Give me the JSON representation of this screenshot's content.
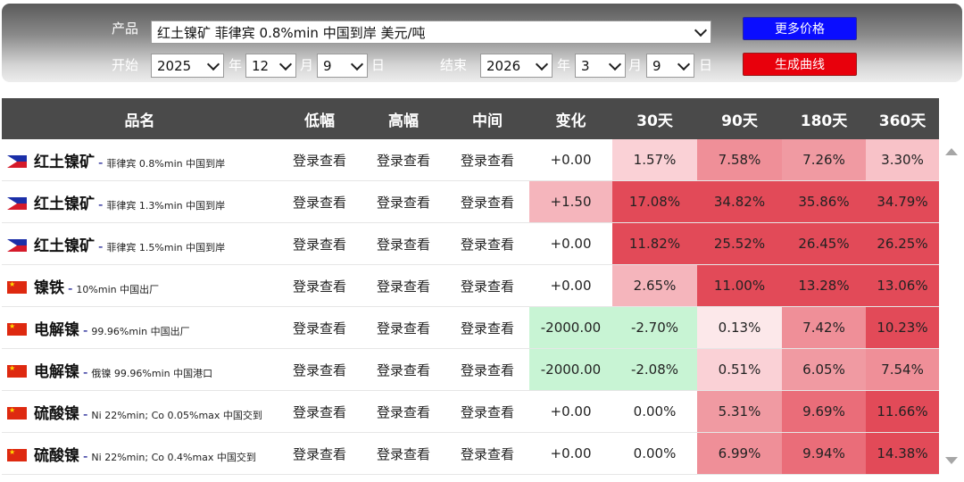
{
  "filter": {
    "product_label": "产品",
    "product_value": "红土镍矿 菲律宾 0.8%min 中国到岸 美元/吨",
    "start_label": "开始",
    "end_label": "结束",
    "start_year": "2025",
    "start_month": "12",
    "start_day": "9",
    "end_year": "2026",
    "end_month": "3",
    "end_day": "9",
    "year_unit": "年",
    "month_unit": "月",
    "day_unit": "日",
    "more_prices_label": "更多价格",
    "generate_curve_label": "生成曲线"
  },
  "table": {
    "headers": [
      "品名",
      "低幅",
      "高幅",
      "中间",
      "变化",
      "30天",
      "90天",
      "180天",
      "360天"
    ],
    "rows": [
      {
        "name": "红土镍矿",
        "spec": "菲律宾 0.8%min 中国到岸",
        "flag": "flag-philippines",
        "low": "登录查看",
        "high": "登录查看",
        "mid": "登录查看",
        "change": "+0.00",
        "d30": "1.57%",
        "d90": "7.58%",
        "d180": "7.26%",
        "d360": "3.30%"
      },
      {
        "name": "红土镍矿",
        "spec": "菲律宾 1.3%min 中国到岸",
        "flag": "flag-philippines",
        "low": "登录查看",
        "high": "登录查看",
        "mid": "登录查看",
        "change": "+1.50",
        "d30": "17.08%",
        "d90": "34.82%",
        "d180": "35.86%",
        "d360": "34.79%"
      },
      {
        "name": "红土镍矿",
        "spec": "菲律宾 1.5%min 中国到岸",
        "flag": "flag-philippines",
        "low": "登录查看",
        "high": "登录查看",
        "mid": "登录查看",
        "change": "+0.00",
        "d30": "11.82%",
        "d90": "25.52%",
        "d180": "26.45%",
        "d360": "26.25%"
      },
      {
        "name": "镍铁",
        "spec": "10%min 中国出厂",
        "flag": "flag-china",
        "low": "登录查看",
        "high": "登录查看",
        "mid": "登录查看",
        "change": "+0.00",
        "d30": "2.65%",
        "d90": "11.00%",
        "d180": "13.28%",
        "d360": "13.06%"
      },
      {
        "name": "电解镍",
        "spec": "99.96%min 中国出厂",
        "flag": "flag-china",
        "low": "登录查看",
        "high": "登录查看",
        "mid": "登录查看",
        "change": "-2000.00",
        "d30": "-2.70%",
        "d90": "0.13%",
        "d180": "7.42%",
        "d360": "10.23%"
      },
      {
        "name": "电解镍",
        "spec": "俄镍 99.96%min 中国港口",
        "flag": "flag-china",
        "low": "登录查看",
        "high": "登录查看",
        "mid": "登录查看",
        "change": "-2000.00",
        "d30": "-2.08%",
        "d90": "0.51%",
        "d180": "6.05%",
        "d360": "7.54%"
      },
      {
        "name": "硫酸镍",
        "spec": "Ni 22%min; Co 0.05%max 中国交到",
        "flag": "flag-china",
        "low": "登录查看",
        "high": "登录查看",
        "mid": "登录查看",
        "change": "+0.00",
        "d30": "0.00%",
        "d90": "5.31%",
        "d180": "9.69%",
        "d360": "11.66%"
      },
      {
        "name": "硫酸镍",
        "spec": "Ni 22%min; Co 0.4%max 中国交到",
        "flag": "flag-china",
        "low": "登录查看",
        "high": "登录查看",
        "mid": "登录查看",
        "change": "+0.00",
        "d30": "0.00%",
        "d90": "6.99%",
        "d180": "9.94%",
        "d360": "14.38%"
      }
    ]
  },
  "colors": {
    "header_bg": "#4a4a4a",
    "more_prices_button": "#0a0dff",
    "generate_curve_button": "#e8000c",
    "increase_strong": "#e24a58",
    "decrease": "#c8f4d4"
  }
}
